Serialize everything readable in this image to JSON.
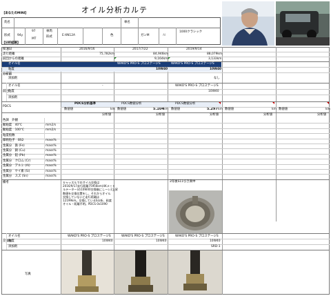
{
  "title": "オイル分析カルテ",
  "owner": {
    "section": "【あなたのMINI】",
    "name_label": "氏名",
    "car_label": "車名",
    "model_label": "形式",
    "year_line1": "97",
    "year_line2": "MT",
    "engine_line1": "E-XN12A",
    "year_value": "94y",
    "type_label_1": "車両",
    "type_label_2": "形式",
    "color_label": "色",
    "color_value": "ガンM",
    "grade_value": "1000クラシック",
    "small_tag": "AI"
  },
  "analysis": {
    "section": "【分析結果】",
    "col_label_sample_date": "採油日",
    "col_label_odo": "走行距離",
    "col_label_since": "前回からの距離",
    "dates": [
      "2016/9/16",
      "2017/7/22",
      "2019/9/14"
    ],
    "odo": [
      "75,782km",
      "84,946km",
      "88,079km"
    ],
    "since": [
      "",
      "9,164km",
      "3,133km"
    ],
    "spec_group": "分析前",
    "oil_name_label": "オイル名",
    "viscosity_label": "粘度",
    "additive_label": "添加剤",
    "oil_names": [
      "",
      "WAKO'S PRO-S プロステージS",
      "WAKO'S PRO-S プロステージS"
    ],
    "viscosities": [
      "",
      "10W40",
      "10W40"
    ],
    "additives": [
      "",
      "",
      "なし"
    ],
    "prev_group": "前回",
    "prev_oil": "オイル名",
    "prev_visc": "粘度",
    "prev_add": "添加剤",
    "prev_oil_values": [
      "-",
      "WAKO'S PRO-S プロステージS"
    ],
    "prev_visc_values": [
      "",
      "10W40"
    ],
    "pdcs_label": "PDCS",
    "pdcs_head": [
      "PDCS分析基準",
      "PDCS数値分析",
      "PDCS数値分析"
    ],
    "pdcs_values": [
      "",
      "5.104",
      "5.297"
    ],
    "pdcs_sub": [
      "数値値",
      "km",
      "数値値",
      "km",
      "数値値",
      "km"
    ],
    "judge_label": "分析値",
    "judge_head": "判定",
    "items": [
      {
        "name": "色調　外観",
        "unit": ""
      },
      {
        "name": "動粘度　40℃",
        "unit": "mm2/s"
      },
      {
        "name": "動粘度　100℃",
        "unit": "mm2/s"
      },
      {
        "name": "粘度指数",
        "unit": ""
      },
      {
        "name": "摩耗粒子　BS2",
        "unit": "mass%"
      },
      {
        "name": "金属分　鉄 (Fe)",
        "unit": "mass%"
      },
      {
        "name": "金属分　銅 (Cu)",
        "unit": "mass%"
      },
      {
        "name": "金属分　鉛 (Pb)",
        "unit": "mass%"
      },
      {
        "name": "金属分　クロム (Cr)",
        "unit": "mass%"
      },
      {
        "name": "金属分　アルミ (Al)",
        "unit": "mass%"
      },
      {
        "name": "金属分　ケイ素 (Si)",
        "unit": "mass%"
      },
      {
        "name": "金属分　スズ (Sn)",
        "unit": "mass%"
      }
    ],
    "remarks_label": "備考",
    "remarks_text": "キャッスルでのオイル交換は\n2016/9/17走行距離75956km(4Kメート\nルテーター)の10W40交換後にしーシ2上昇\n数値を交換位置をし、それからオイル\n交換していないと走行距離は\n12199km。交換しているS分析、粘度\nオイル・距離不明。PDCS 0x1090",
    "remarks_photo_caption": "2年後S11引き真中",
    "next_group": "交換後",
    "next_oil": "オイル名",
    "next_visc": "粘度",
    "next_add": "添加剤",
    "next_oil_values": [
      "WAKO'S PRO-S プロステージS",
      "WAKO'S PRO-S プロステージS",
      "WAKO'S PRO-S プロステージS"
    ],
    "next_visc_values": [
      "10W40",
      "10W40",
      "10W40"
    ],
    "next_add_values": [
      "",
      "",
      "SRD-1"
    ],
    "magnet_label": "写真"
  },
  "colors": {
    "navy": "#1a3d78",
    "red_marker": "#cc0000",
    "green_marker": "#2a8a2a"
  }
}
